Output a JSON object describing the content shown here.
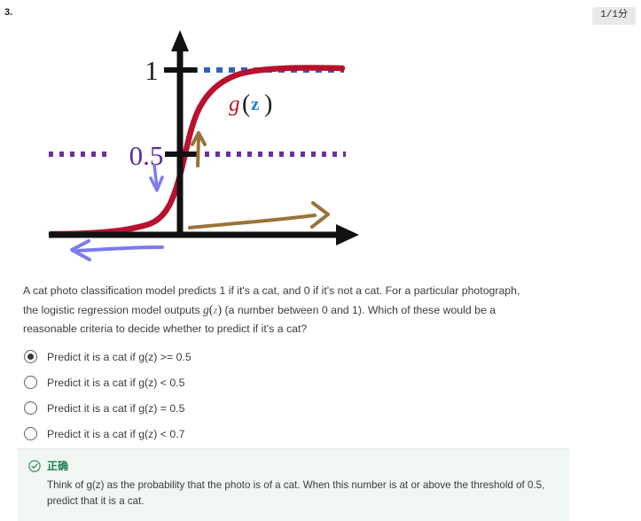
{
  "question_number": "3.",
  "score_badge": "1/1分",
  "figure": {
    "alt_name": "sigmoid-logistic-function-graph",
    "curve_label_g": "g",
    "curve_label_paren_open": "(",
    "curve_label_z": "z",
    "curve_label_paren_close": ")",
    "y_tick_one": "1",
    "y_tick_half": "0.5",
    "colors": {
      "curve": "#b8112e",
      "axis": "#111111",
      "dash_one": "#2f5fc4",
      "dash_half": "#6b2fa0",
      "label_half": "#5b2a9e",
      "annotation_blue": "#7b7bee",
      "annotation_brown": "#9a7339",
      "label_z": "#1f7fe8"
    }
  },
  "question": {
    "part1": "A cat photo classification model predicts 1 if it's a cat, and 0 if it's not a cat. For a particular photograph, the logistic regression model outputs ",
    "math_g": "g",
    "math_open": "(",
    "math_z": "z",
    "math_close": ")",
    "part2": " (a number between 0 and 1). Which of these would be a reasonable criteria to decide whether to predict if it's a cat?"
  },
  "options": [
    {
      "label": "Predict it is a cat if g(z) >= 0.5",
      "selected": true
    },
    {
      "label": "Predict it is a cat if g(z) < 0.5",
      "selected": false
    },
    {
      "label": "Predict it is a cat if g(z) = 0.5",
      "selected": false
    },
    {
      "label": "Predict it is a cat if g(z) < 0.7",
      "selected": false
    }
  ],
  "feedback": {
    "icon": "circle-check-icon",
    "title": "正确",
    "text": "Think of g(z) as the probability that the photo is of a cat. When this number is at or above the threshold of 0.5, predict that it is a cat.",
    "accent_color": "#1b7a53",
    "background_color": "#f0f7f3"
  }
}
